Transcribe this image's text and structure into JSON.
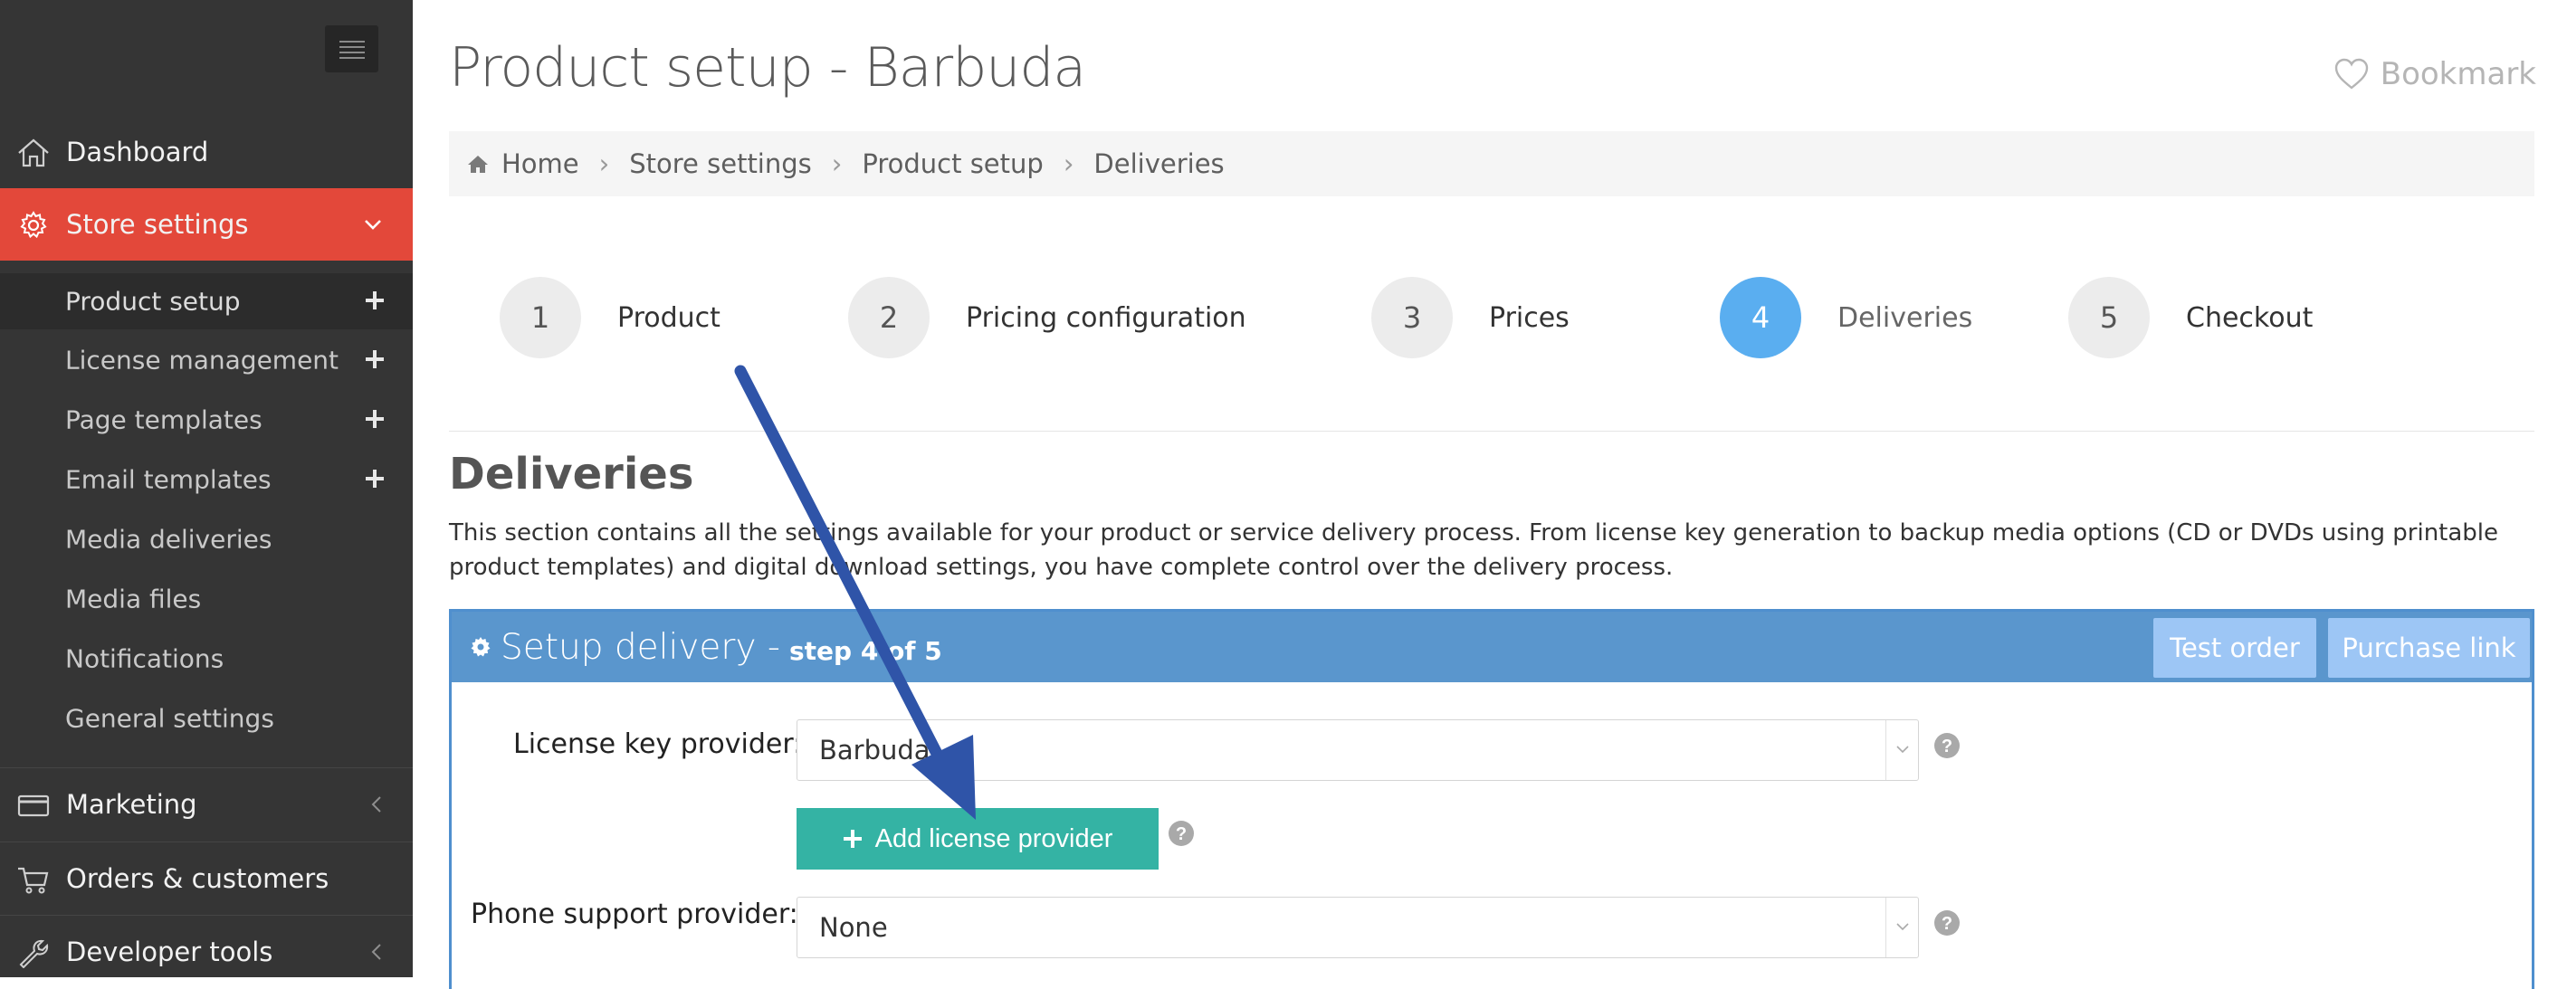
{
  "sidebar": {
    "nav": {
      "dashboard": "Dashboard",
      "store_settings": "Store settings",
      "marketing": "Marketing",
      "orders": "Orders & customers",
      "developer": "Developer tools"
    },
    "submenu": [
      {
        "label": "Product setup",
        "has_plus": true,
        "active": true
      },
      {
        "label": "License management",
        "has_plus": true
      },
      {
        "label": "Page templates",
        "has_plus": true
      },
      {
        "label": "Email templates",
        "has_plus": true
      },
      {
        "label": "Media deliveries"
      },
      {
        "label": "Media files"
      },
      {
        "label": "Notifications"
      },
      {
        "label": "General settings"
      }
    ],
    "active_color": "#e3483a"
  },
  "header": {
    "title": "Product setup - Barbuda",
    "bookmark": "Bookmark"
  },
  "breadcrumb": [
    "Home",
    "Store settings",
    "Product setup",
    "Deliveries"
  ],
  "steps": [
    {
      "num": "1",
      "label": "Product"
    },
    {
      "num": "2",
      "label": "Pricing configuration"
    },
    {
      "num": "3",
      "label": "Prices"
    },
    {
      "num": "4",
      "label": "Deliveries",
      "active": true
    },
    {
      "num": "5",
      "label": "Checkout"
    }
  ],
  "section": {
    "title": "Deliveries",
    "description": "This section contains all the settings available for your product or service delivery process. From license key generation to backup media options (CD or DVDs using printable product templates) and digital download settings, you have complete control over the delivery process."
  },
  "panel": {
    "title": "Setup delivery -",
    "step": "step 4 of 5",
    "test_order": "Test order",
    "purchase_link": "Purchase link",
    "license_label": "License key provider:",
    "license_value": "Barbuda",
    "add_provider": "Add license provider",
    "phone_label": "Phone support provider:",
    "phone_value": "None"
  },
  "colors": {
    "panel_header": "#5a96cd",
    "add_button": "#34b3a4",
    "active_step": "#5aaef0",
    "arrow": "#2f54a8"
  }
}
